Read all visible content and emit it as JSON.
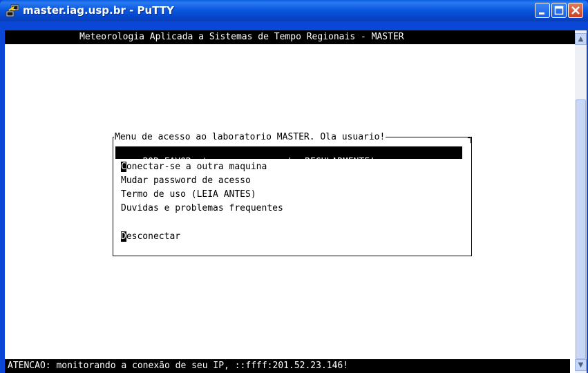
{
  "window": {
    "title": "master.iag.usp.br - PuTTY",
    "icon": "putty-icon",
    "controls": {
      "minimize": "minimize",
      "maximize": "maximize",
      "close": "close"
    }
  },
  "terminal": {
    "header": "Meteorologia Aplicada a Sistemas de Tempo Regionais - MASTER",
    "menu": {
      "title": "Menu de acesso ao laboratorio MASTER. Ola usuario!",
      "selected_item": "POR FAVOR: troque a sua senha REGULARMENTE!",
      "items": [
        {
          "first": "C",
          "rest": "onectar-se a outra maquina"
        },
        {
          "first": "",
          "rest": "Mudar password de acesso"
        },
        {
          "first": "",
          "rest": "Termo de uso (LEIA ANTES)"
        },
        {
          "first": "",
          "rest": "Duvidas e problemas frequentes"
        }
      ],
      "disconnect": {
        "first": "D",
        "rest": "esconectar"
      }
    },
    "status": "ATENCAO: monitorando a conexão de seu IP, ::ffff:201.52.23.146!"
  },
  "colors": {
    "titlebar": "#0a58e0",
    "terminal_bg": "#ffffff",
    "terminal_fg": "#000000",
    "highlight": "#000000"
  }
}
